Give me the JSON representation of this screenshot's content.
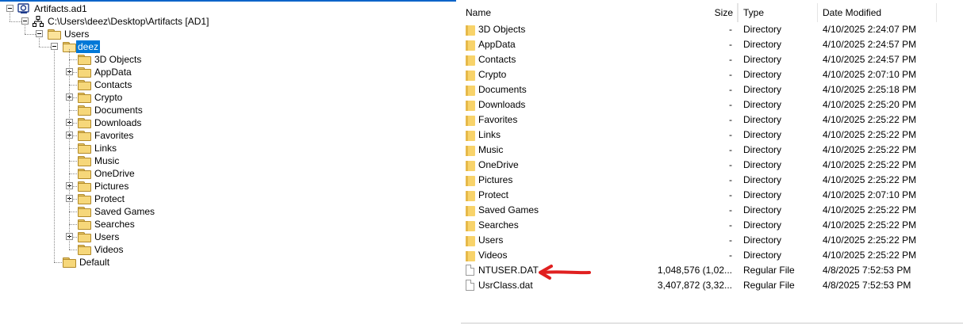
{
  "tree": {
    "root_label": "Artifacts.ad1",
    "image_label": "C:\\Users\\deez\\Desktop\\Artifacts [AD1]",
    "users_label": "Users",
    "selected_label": "deez",
    "children": [
      "3D Objects",
      "AppData",
      "Contacts",
      "Crypto",
      "Documents",
      "Downloads",
      "Favorites",
      "Links",
      "Music",
      "OneDrive",
      "Pictures",
      "Protect",
      "Saved Games",
      "Searches",
      "Users",
      "Videos"
    ],
    "expandable_children": [
      "AppData",
      "Crypto",
      "Downloads",
      "Favorites",
      "Pictures",
      "Protect",
      "Users"
    ],
    "default_label": "Default"
  },
  "list": {
    "headers": {
      "name": "Name",
      "size": "Size",
      "type": "Type",
      "date": "Date Modified"
    },
    "rows": [
      {
        "name": "3D Objects",
        "size": "-",
        "type": "Directory",
        "date": "4/10/2025 2:24:07 PM",
        "icon": "folder-icon"
      },
      {
        "name": "AppData",
        "size": "-",
        "type": "Directory",
        "date": "4/10/2025 2:24:57 PM",
        "icon": "folder-icon"
      },
      {
        "name": "Contacts",
        "size": "-",
        "type": "Directory",
        "date": "4/10/2025 2:24:57 PM",
        "icon": "folder-icon"
      },
      {
        "name": "Crypto",
        "size": "-",
        "type": "Directory",
        "date": "4/10/2025 2:07:10 PM",
        "icon": "folder-icon"
      },
      {
        "name": "Documents",
        "size": "-",
        "type": "Directory",
        "date": "4/10/2025 2:25:18 PM",
        "icon": "folder-icon"
      },
      {
        "name": "Downloads",
        "size": "-",
        "type": "Directory",
        "date": "4/10/2025 2:25:20 PM",
        "icon": "folder-icon"
      },
      {
        "name": "Favorites",
        "size": "-",
        "type": "Directory",
        "date": "4/10/2025 2:25:22 PM",
        "icon": "folder-icon"
      },
      {
        "name": "Links",
        "size": "-",
        "type": "Directory",
        "date": "4/10/2025 2:25:22 PM",
        "icon": "folder-icon"
      },
      {
        "name": "Music",
        "size": "-",
        "type": "Directory",
        "date": "4/10/2025 2:25:22 PM",
        "icon": "folder-icon"
      },
      {
        "name": "OneDrive",
        "size": "-",
        "type": "Directory",
        "date": "4/10/2025 2:25:22 PM",
        "icon": "folder-icon"
      },
      {
        "name": "Pictures",
        "size": "-",
        "type": "Directory",
        "date": "4/10/2025 2:25:22 PM",
        "icon": "folder-icon"
      },
      {
        "name": "Protect",
        "size": "-",
        "type": "Directory",
        "date": "4/10/2025 2:07:10 PM",
        "icon": "folder-icon"
      },
      {
        "name": "Saved Games",
        "size": "-",
        "type": "Directory",
        "date": "4/10/2025 2:25:22 PM",
        "icon": "folder-icon"
      },
      {
        "name": "Searches",
        "size": "-",
        "type": "Directory",
        "date": "4/10/2025 2:25:22 PM",
        "icon": "folder-icon"
      },
      {
        "name": "Users",
        "size": "-",
        "type": "Directory",
        "date": "4/10/2025 2:25:22 PM",
        "icon": "folder-icon"
      },
      {
        "name": "Videos",
        "size": "-",
        "type": "Directory",
        "date": "4/10/2025 2:25:22 PM",
        "icon": "folder-icon"
      },
      {
        "name": "NTUSER.DAT",
        "size": "1,048,576 (1,02...",
        "type": "Regular File",
        "date": "4/8/2025 7:52:53 PM",
        "icon": "file-icon"
      },
      {
        "name": "UsrClass.dat",
        "size": "3,407,872 (3,32...",
        "type": "Regular File",
        "date": "4/8/2025 7:52:53 PM",
        "icon": "file-icon"
      }
    ]
  },
  "colors": {
    "selection": "#0078d7",
    "folder": "#f8d36a",
    "arrow": "#e02020",
    "accent_line": "#0a64c9"
  }
}
